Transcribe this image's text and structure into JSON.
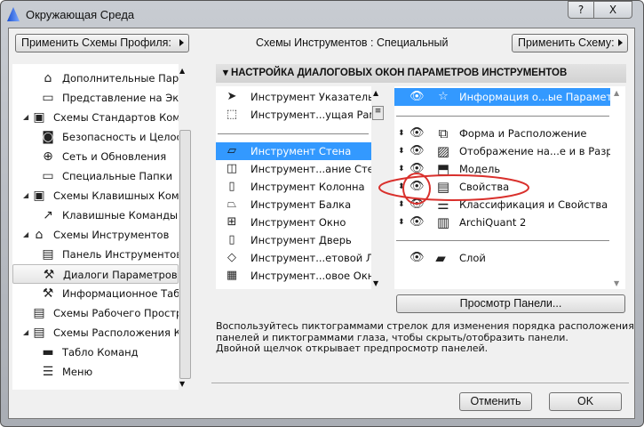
{
  "window": {
    "title": "Окружающая Среда",
    "help": "?",
    "close": "X"
  },
  "top": {
    "apply_profile": "Применить Схемы Профиля:",
    "scheme_label": "Схемы Инструментов :  Специальный",
    "apply_scheme": "Применить Схему:"
  },
  "tree": [
    {
      "label": "Дополнительные Парам",
      "level": 2,
      "icon": "house-icon"
    },
    {
      "label": "Представление на Экран",
      "level": 2,
      "icon": "monitor-icon"
    },
    {
      "label": "Схемы Стандартов Компан",
      "level": 1,
      "icon": "standards-icon",
      "expanded": true
    },
    {
      "label": "Безопасность и Целостн",
      "level": 2,
      "icon": "security-icon"
    },
    {
      "label": "Сеть и Обновления",
      "level": 2,
      "icon": "globe-icon"
    },
    {
      "label": "Специальные Папки",
      "level": 2,
      "icon": "folder-icon"
    },
    {
      "label": "Схемы Клавишных Команд",
      "level": 1,
      "icon": "shortcut-scheme-icon",
      "expanded": true
    },
    {
      "label": "Клавишные Команды",
      "level": 2,
      "icon": "shortcut-icon"
    },
    {
      "label": "Схемы Инструментов",
      "level": 1,
      "icon": "tool-scheme-icon",
      "expanded": true
    },
    {
      "label": "Панель Инструментов",
      "level": 2,
      "icon": "toolbox-icon"
    },
    {
      "label": "Диалоги Параметров Ин",
      "level": 2,
      "icon": "hammer-icon",
      "selected": true
    },
    {
      "label": "Информационное Табло",
      "level": 2,
      "icon": "info-box-icon"
    },
    {
      "label": "Схемы Рабочего Простран",
      "level": 1,
      "icon": "workspace-icon"
    },
    {
      "label": "Схемы Расположения Ком",
      "level": 1,
      "icon": "layout-icon",
      "expanded": true
    },
    {
      "label": "Табло Команд",
      "level": 2,
      "icon": "toolbar-icon"
    },
    {
      "label": "Меню",
      "level": 2,
      "icon": "menu-icon"
    }
  ],
  "header": "НАСТРОЙКА ДИАЛОГОВЫХ ОКОН ПАРАМЕТРОВ ИНСТРУМЕНТОВ",
  "tools_top": [
    {
      "label": "Инструмент Указатель",
      "icon": "arrow-icon",
      "glyph": "➤"
    },
    {
      "label": "Инструмент...ущая Рамка",
      "icon": "marquee-icon",
      "glyph": "⬚"
    }
  ],
  "tools": [
    {
      "label": "Инструмент Стена",
      "icon": "wall-icon",
      "glyph": "▱",
      "selected": true
    },
    {
      "label": "Инструмент...ание Стены",
      "icon": "curtain-wall-icon",
      "glyph": "◫"
    },
    {
      "label": "Инструмент Колонна",
      "icon": "column-icon",
      "glyph": "▯"
    },
    {
      "label": "Инструмент Балка",
      "icon": "beam-icon",
      "glyph": "⏢"
    },
    {
      "label": "Инструмент Окно",
      "icon": "window-icon",
      "glyph": "⊞"
    },
    {
      "label": "Инструмент Дверь",
      "icon": "door-icon",
      "glyph": "▯"
    },
    {
      "label": "Инструмент...етовой Люк",
      "icon": "skylight-icon",
      "glyph": "◇"
    },
    {
      "label": "Инструмент...овое Окно",
      "icon": "corner-window-icon",
      "glyph": "▦"
    }
  ],
  "panels_top": {
    "label": "Информация о...ые Параметры",
    "icon": "star-icon",
    "glyph": "☆"
  },
  "panels": [
    {
      "label": "Форма и Расположение",
      "icon": "shape-icon",
      "glyph": "⧉"
    },
    {
      "label": "Отображение на...е и в Разрезе",
      "icon": "hatch-icon",
      "glyph": "▨"
    },
    {
      "label": "Модель",
      "icon": "model-icon",
      "glyph": "⬒"
    },
    {
      "label": "Свойства",
      "icon": "properties-icon",
      "glyph": "▤"
    },
    {
      "label": "Классификация и Свойства",
      "icon": "classification-icon",
      "glyph": "☰"
    },
    {
      "label": "ArchiQuant 2",
      "icon": "archiquant-icon",
      "glyph": "▥"
    }
  ],
  "panels_bottom": {
    "label": "Слой",
    "icon": "layer-icon",
    "glyph": "▰"
  },
  "preview_button": "Просмотр Панели...",
  "hint": [
    "Воспользуйтесь пиктограммами стрелок для изменения порядка расположения",
    "панелей и пиктограммами глаза, чтобы скрыть/отобразить панели.",
    "Двойной щелчок открывает предпросмотр панелей."
  ],
  "cancel": "Отменить",
  "ok": "OK",
  "colors": {
    "selection": "#3399ff",
    "annotation": "#d9302c"
  }
}
